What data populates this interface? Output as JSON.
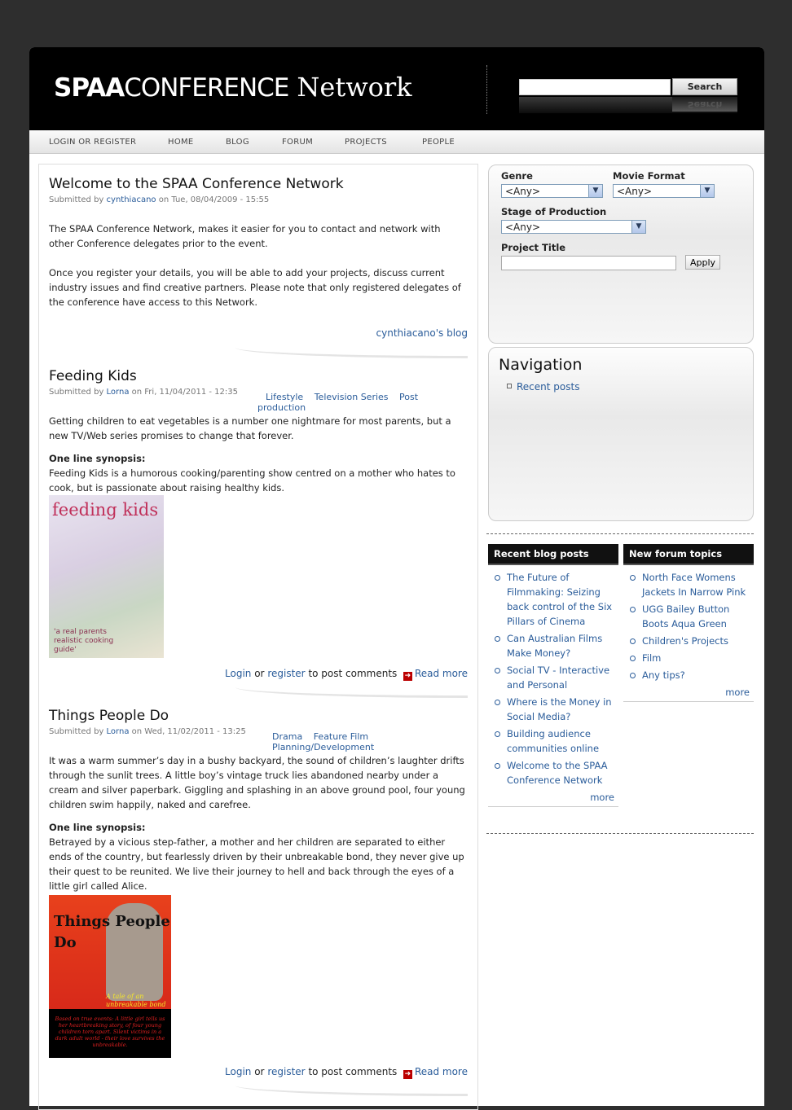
{
  "header": {
    "logo_bold": "SPAA",
    "logo_light": "CONFERENCE",
    "logo_serif": "Network",
    "search_button": "Search",
    "search_button_reflection": "Search"
  },
  "nav": {
    "items": [
      "LOGIN OR REGISTER",
      "HOME",
      "BLOG",
      "FORUM",
      "PROJECTS",
      "PEOPLE"
    ]
  },
  "posts": [
    {
      "title": "Welcome to the SPAA Conference Network",
      "submitted_prefix": "Submitted by",
      "author": "cynthiacano",
      "submitted_suffix": "on Tue, 08/04/2009 - 15:55",
      "paragraphs": [
        "The SPAA Conference Network, makes it easier for you to contact and network with other Conference delegates prior to the event.",
        "Once you register your details, you will be able to add your projects, discuss current industry issues and find creative partners.  Please note that only registered delegates of the conference have access to this Network."
      ],
      "blog_link": "cynthiacano's blog"
    },
    {
      "title": "Feeding Kids",
      "submitted_prefix": "Submitted by",
      "author": "Lorna",
      "submitted_suffix": "on Fri, 11/04/2011 - 12:35",
      "terms": [
        "Lifestyle",
        "Television Series",
        "Post production"
      ],
      "paragraph": "Getting children to eat vegetables is a number one nightmare for most parents, but a new TV/Web series promises to change that forever.",
      "synopsis_label": "One line synopsis:",
      "synopsis": "Feeding Kids is a humorous cooking/parenting show centred on a mother who hates to cook, but is passionate about raising healthy kids.",
      "poster_title": "feeding kids",
      "poster_tagline": "'a real parents realistic cooking guide'",
      "login": "Login",
      "or": "or",
      "register": "register",
      "to_post": "to post comments",
      "read_more": "Read more"
    },
    {
      "title": "Things People Do",
      "submitted_prefix": "Submitted by",
      "author": "Lorna",
      "submitted_suffix": "on Wed, 11/02/2011 - 13:25",
      "terms": [
        "Drama",
        "Feature Film",
        "Planning/Development"
      ],
      "paragraph": "It was a warm summer’s day in a bushy backyard, the sound of children’s laughter drifts through the sunlit trees. A little boy’s vintage truck lies abandoned nearby under a cream and silver paperbark. Giggling and splashing in an above ground pool, four young children swim happily, naked and carefree.",
      "synopsis_label": "One line synopsis:",
      "synopsis": "Betrayed by a vicious step-father, a mother and her children are separated to either ends of the country, but fearlessly driven by their unbreakable bond, they never give up their quest to be reunited. We live their journey to hell and back through the eyes of a little girl called Alice.",
      "poster_title": "Things People Do",
      "poster_tagline": "A tale of an unbreakable bond",
      "poster_bottom": "Based on true events: A little girl tells us her heartbreaking story, of four young children torn apart.  Silent victims in a dark adult world - their love survives the unbreakable.",
      "login": "Login",
      "or": "or",
      "register": "register",
      "to_post": "to post comments",
      "read_more": "Read more"
    }
  ],
  "filter": {
    "genre_label": "Genre",
    "genre_value": "<Any>",
    "format_label": "Movie Format",
    "format_value": "<Any>",
    "stage_label": "Stage of Production",
    "stage_value": "<Any>",
    "title_label": "Project Title",
    "title_value": "",
    "apply": "Apply"
  },
  "navigation": {
    "title": "Navigation",
    "items": [
      "Recent posts"
    ]
  },
  "recent_blog": {
    "title": "Recent blog posts",
    "items": [
      "The Future of Filmmaking: Seizing back control of the Six Pillars of Cinema",
      "Can Australian Films Make Money?",
      "Social TV - Interactive and Personal",
      "Where is the Money in Social Media?",
      "Building audience communities online",
      "Welcome to the SPAA Conference Network"
    ],
    "more": "more"
  },
  "forum_topics": {
    "title": "New forum topics",
    "items": [
      "North Face Womens Jackets In Narrow Pink",
      "UGG Bailey Button Boots Aqua Green",
      "Children's Projects",
      "Film",
      "Any tips?"
    ],
    "more": "more"
  },
  "colors": {
    "link": "#2a5c9a",
    "header_bg": "#000000",
    "page_bg": "#2e2e2e"
  }
}
